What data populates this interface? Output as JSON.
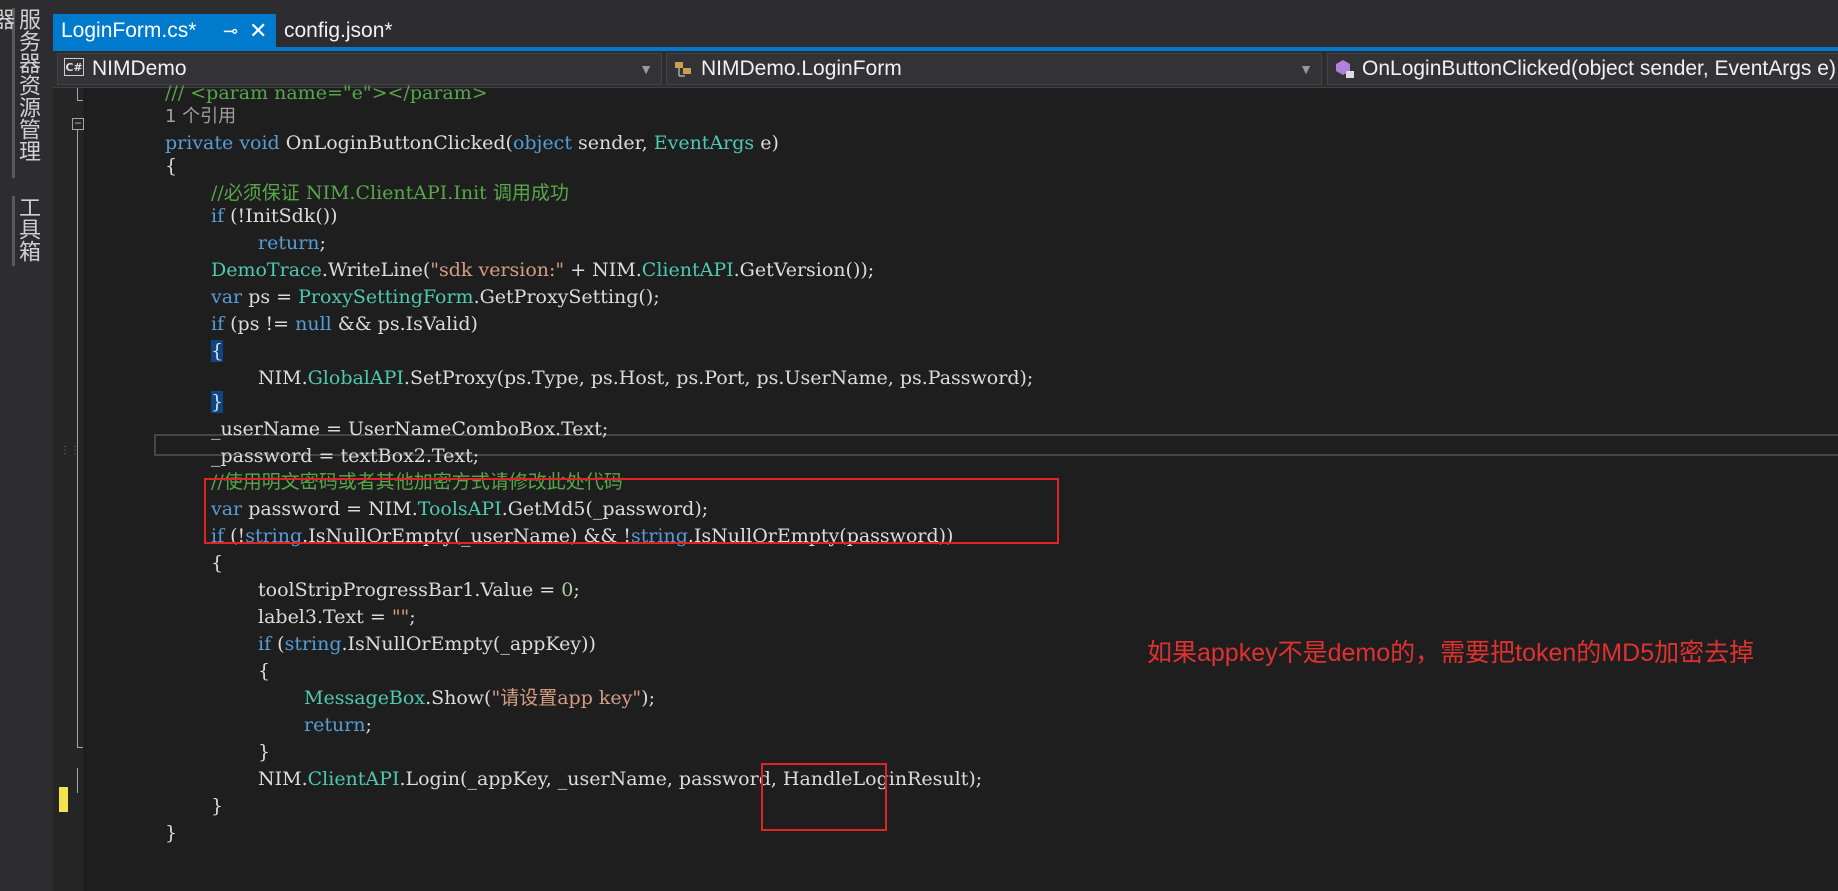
{
  "side_panel": {
    "server_explorer": "服务器资源管理器",
    "toolbox": "工具箱"
  },
  "tabs": [
    {
      "label": "LoginForm.cs*",
      "active": true,
      "pin_icon": "pin-icon",
      "close_icon": "close-icon"
    },
    {
      "label": "config.json*",
      "active": false
    }
  ],
  "nav": {
    "project": "NIMDemo",
    "class": "NIMDemo.LoginForm",
    "member": "OnLoginButtonClicked(object sender, EventArgs e)"
  },
  "code": {
    "l0": "/// <param name=\"e\"></param>",
    "ref_count": "1 个引用",
    "sig_private": "private",
    "sig_void": "void",
    "sig_name": " OnLoginButtonClicked(",
    "sig_object": "object",
    "sig_sender": " sender, ",
    "sig_eventargs": "EventArgs",
    "sig_end": " e)",
    "open_brace": "{",
    "comment_init": "//必须保证 NIM.ClientAPI.Init 调用成功",
    "if1_kw": "if",
    "if1_rest": " (!InitSdk())",
    "return_kw": "return",
    "semi": ";",
    "trace_type": "DemoTrace",
    "trace_a": ".WriteLine(",
    "trace_str": "\"sdk version:\"",
    "trace_b": " + NIM.",
    "trace_clientapi": "ClientAPI",
    "trace_c": ".GetVersion());",
    "var_kw": "var",
    "ps_a": " ps = ",
    "ps_type": "ProxySettingForm",
    "ps_b": ".GetProxySetting();",
    "if2_kw": "if",
    "if2_a": " (ps != ",
    "null_kw": "null",
    "if2_b": " && ps.IsValid)",
    "inner_open": "{",
    "proxy_a": "NIM.",
    "proxy_type": "GlobalAPI",
    "proxy_b": ".SetProxy(ps.Type, ps.Host, ps.Port, ps.UserName, ps.Password);",
    "inner_close": "}",
    "username_line": "_userName = UserNameComboBox.Text;",
    "password_line": "_password = textBox2.Text;",
    "comment_encrypt": "//使用明文密码或者其他加密方式请修改此处代码",
    "md5_var": "var",
    "md5_a": " password = NIM.",
    "md5_type": "ToolsAPI",
    "md5_b": ".GetMd5(_password);",
    "if3_kw": "if",
    "if3_a": " (!",
    "string_kw": "string",
    "if3_b": ".IsNullOrEmpty(_userName) && !",
    "if3_c": ".IsNullOrEmpty(password))",
    "block_open": "{",
    "progress_a": "toolStripProgressBar1.Value = ",
    "progress_num": "0",
    "progress_b": ";",
    "label_a": "label3.Text = ",
    "label_str": "\"\"",
    "label_b": ";",
    "if4_kw": "if",
    "if4_a": " (",
    "if4_b": ".IsNullOrEmpty(_appKey))",
    "block2_open": "{",
    "msg_type": "MessageBox",
    "msg_a": ".Show(",
    "msg_str": "\"请设置app key\"",
    "msg_b": ");",
    "return2_kw": "return",
    "block2_close": "}",
    "login_a": "NIM.",
    "login_type": "ClientAPI",
    "login_b": ".Login(_appKey, _userName, password, HandleLoginResult);",
    "block_close": "}",
    "method_close": "}"
  },
  "annotation": "如果appkey不是demo的，需要把token的MD5加密去掉",
  "colors": {
    "accent": "#007acc",
    "annotation_red": "#e02424",
    "keyword": "#569cd6",
    "type": "#4ec9b0",
    "comment": "#57a64a",
    "string": "#d69d85"
  }
}
